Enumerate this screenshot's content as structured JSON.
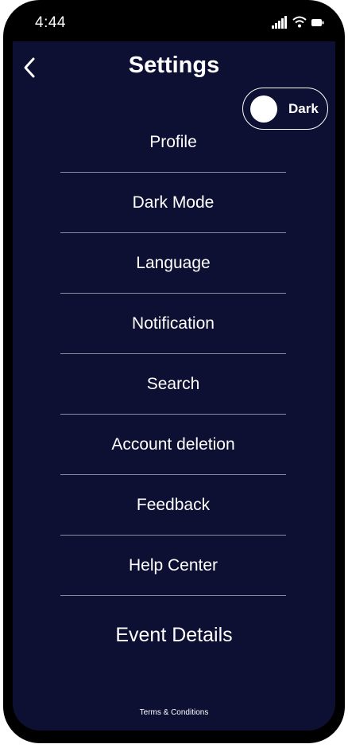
{
  "status_bar": {
    "time": "4:44",
    "icons": [
      "signal-icon",
      "wifi-icon",
      "battery-icon"
    ]
  },
  "header": {
    "back_icon": "chevron-left-icon",
    "title": "Settings"
  },
  "theme_toggle": {
    "label": "Dark"
  },
  "menu": {
    "items": [
      {
        "label": "Profile"
      },
      {
        "label": "Dark Mode"
      },
      {
        "label": "Language"
      },
      {
        "label": "Notification"
      },
      {
        "label": "Search"
      },
      {
        "label": "Account deletion"
      },
      {
        "label": "Feedback"
      },
      {
        "label": "Help Center"
      }
    ]
  },
  "event_details": {
    "label": "Event Details"
  },
  "footer": {
    "terms_label": "Terms & Conditions"
  },
  "colors": {
    "background": "#0e1033",
    "frame": "#000000",
    "text": "#ffffff",
    "divider": "#8a8ca6"
  }
}
